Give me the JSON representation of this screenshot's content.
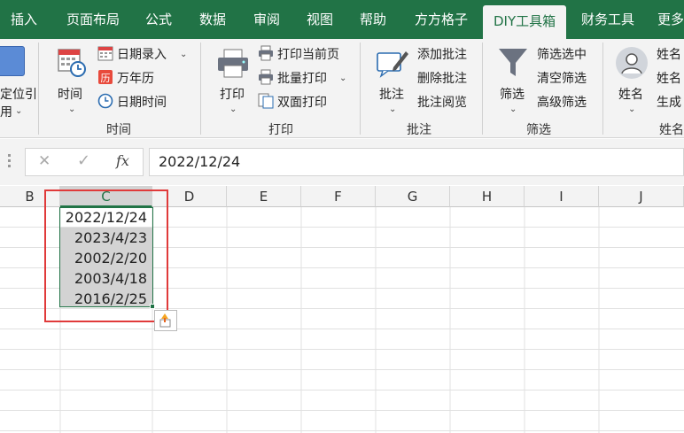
{
  "ribbon_tabs": [
    {
      "label": "插入"
    },
    {
      "label": "页面布局"
    },
    {
      "label": "公式"
    },
    {
      "label": "数据"
    },
    {
      "label": "审阅"
    },
    {
      "label": "视图"
    },
    {
      "label": "帮助"
    },
    {
      "label": "方方格子"
    },
    {
      "label": "DIY工具箱"
    },
    {
      "label": "财务工具"
    },
    {
      "label": "更多"
    }
  ],
  "active_tab": "DIY工具箱",
  "ribbon": {
    "locate_partial_top": "定位引",
    "locate_partial_bottom": "用",
    "time_group": {
      "big_button": "时间",
      "items": [
        "日期录入",
        "万年历",
        "日期时间"
      ],
      "label": "时间"
    },
    "print_group": {
      "big_button": "打印",
      "items": [
        "打印当前页",
        "批量打印",
        "双面打印"
      ],
      "label": "打印"
    },
    "comment_group": {
      "big_button": "批注",
      "items": [
        "添加批注",
        "删除批注",
        "批注阅览"
      ],
      "label": "批注"
    },
    "filter_group": {
      "big_button": "筛选",
      "items": [
        "筛选选中",
        "清空筛选",
        "高级筛选"
      ],
      "label": "筛选"
    },
    "name_group": {
      "big_button": "姓名",
      "items": [
        "姓名",
        "姓名",
        "生成"
      ],
      "label": "姓名"
    }
  },
  "formula_bar": {
    "cancel_symbol": "✕",
    "enter_symbol": "✓",
    "fx_symbol": "fx",
    "value": "2022/12/24"
  },
  "columns": [
    "B",
    "C",
    "D",
    "E",
    "F",
    "G",
    "H",
    "I",
    "J"
  ],
  "selected_column": "C",
  "cells": [
    "2022/12/24",
    "2023/4/23",
    "2002/2/20",
    "2003/4/18",
    "2016/2/25"
  ],
  "colors": {
    "accent": "#217346",
    "selection_fill": "#d3d3d3",
    "highlight_box": "#e03a3a"
  }
}
